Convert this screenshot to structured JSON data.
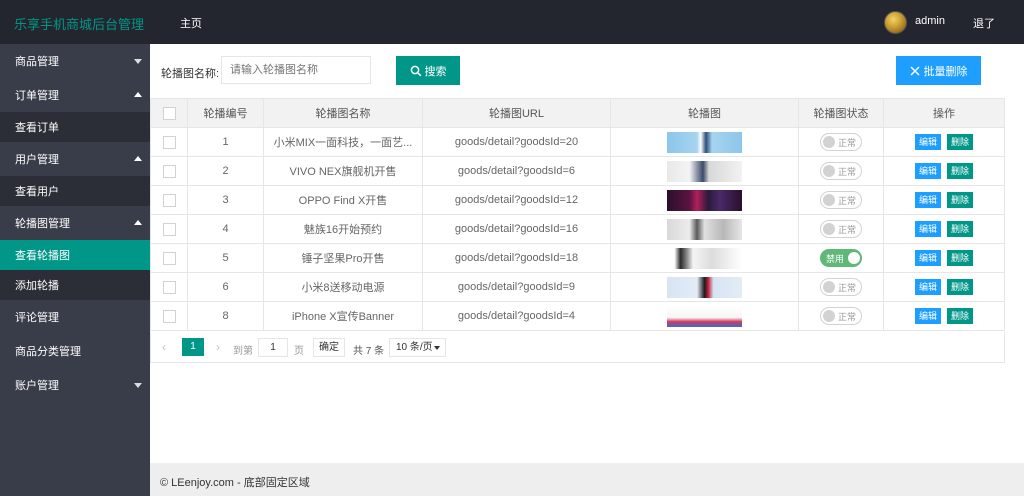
{
  "header": {
    "logo": "乐享手机商城后台管理",
    "home": "主页",
    "user": "admin",
    "logout": "退了"
  },
  "sidebar": {
    "items": [
      {
        "label": "商品管理",
        "type": "group",
        "caret": "down"
      },
      {
        "label": "订单管理",
        "type": "group",
        "caret": "up"
      },
      {
        "label": "查看订单",
        "type": "sub"
      },
      {
        "label": "用户管理",
        "type": "group",
        "caret": "up"
      },
      {
        "label": "查看用户",
        "type": "sub"
      },
      {
        "label": "轮播图管理",
        "type": "group",
        "caret": "up"
      },
      {
        "label": "查看轮播图",
        "type": "sub",
        "active": true
      },
      {
        "label": "添加轮播",
        "type": "sub"
      },
      {
        "label": "评论管理",
        "type": "group"
      },
      {
        "label": "商品分类管理",
        "type": "group"
      },
      {
        "label": "账户管理",
        "type": "group",
        "caret": "down"
      }
    ]
  },
  "search": {
    "label": "轮播图名称:",
    "placeholder": "请输入轮播图名称",
    "button": "搜索"
  },
  "batch_delete": "批量删除",
  "table": {
    "columns": [
      "轮播编号",
      "轮播图名称",
      "轮播图URL",
      "轮播图",
      "轮播图状态",
      "操作"
    ],
    "rows": [
      {
        "id": "1",
        "name": "小米MIX一面科技，一面艺...",
        "url": "goods/detail?goodsId=20",
        "status": "正常",
        "enabled": false,
        "thumb": "thumb-light-blue"
      },
      {
        "id": "2",
        "name": "VIVO NEX旗舰机开售",
        "url": "goods/detail?goodsId=6",
        "status": "正常",
        "enabled": false,
        "thumb": "thumb-white-grey"
      },
      {
        "id": "3",
        "name": "OPPO Find X开售",
        "url": "goods/detail?goodsId=12",
        "status": "正常",
        "enabled": false,
        "thumb": "thumb-dark-purple"
      },
      {
        "id": "4",
        "name": "魅族16开始预约",
        "url": "goods/detail?goodsId=16",
        "status": "正常",
        "enabled": false,
        "thumb": "thumb-light-grey"
      },
      {
        "id": "5",
        "name": "锤子坚果Pro开售",
        "url": "goods/detail?goodsId=18",
        "status": "禁用",
        "enabled": true,
        "thumb": "thumb-white-phones"
      },
      {
        "id": "6",
        "name": "小米8送移动电源",
        "url": "goods/detail?goodsId=9",
        "status": "正常",
        "enabled": false,
        "thumb": "thumb-light-blue-red"
      },
      {
        "id": "8",
        "name": "iPhone X宣传Banner",
        "url": "goods/detail?goodsId=4",
        "status": "正常",
        "enabled": false,
        "thumb": "thumb-white-iphone"
      }
    ],
    "edit_label": "编辑",
    "delete_label": "删除"
  },
  "pager": {
    "current": "1",
    "goto": "到第",
    "input": "1",
    "page": "页",
    "confirm": "确定",
    "total": "共 7 条",
    "size": "10 条/页"
  },
  "footer": "© LEenjoy.com - 底部固定区域",
  "colors": {
    "header_bg": "#23262e",
    "sidebar_bg": "#393d49",
    "sub_bg": "#2b2e37",
    "accent": "#009688",
    "blue": "#1e9fff",
    "switch_on": "#5fb878"
  }
}
